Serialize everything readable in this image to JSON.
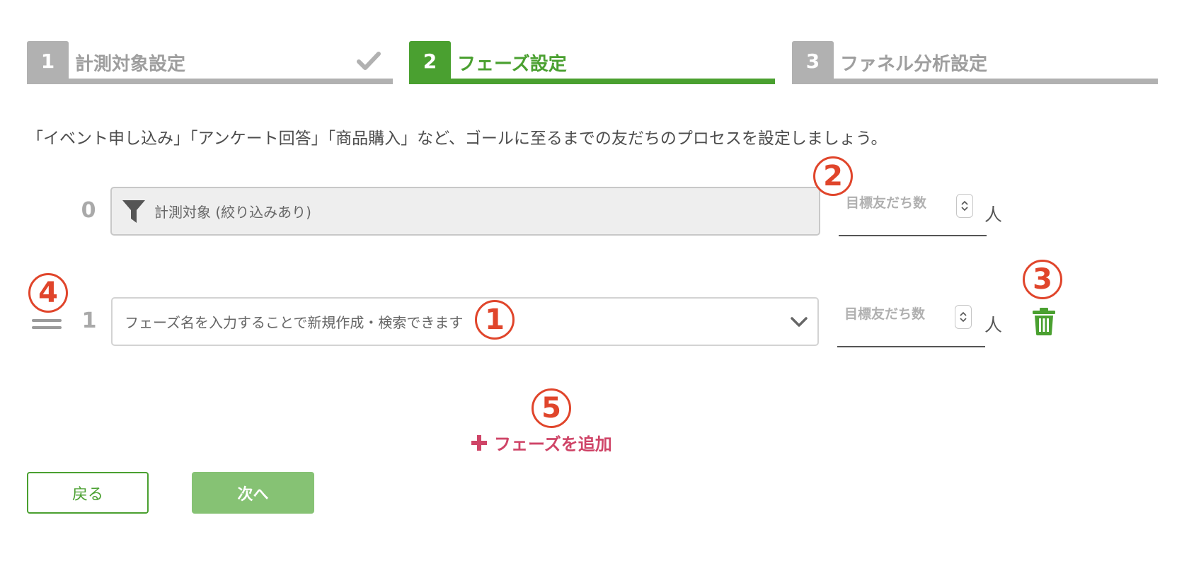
{
  "stepper": [
    {
      "number": "1",
      "label": "計測対象設定",
      "state": "completed"
    },
    {
      "number": "2",
      "label": "フェーズ設定",
      "state": "active"
    },
    {
      "number": "3",
      "label": "ファネル分析設定",
      "state": "upcoming"
    }
  ],
  "description": "「イベント申し込み」「アンケート回答」「商品購入」など、ゴールに至るまでの友だちのプロセスを設定しましょう。",
  "phases": [
    {
      "number": "0",
      "text": "計測対象 (絞り込みあり)",
      "target_label": "目標友だち数",
      "unit": "人"
    },
    {
      "number": "1",
      "placeholder": "フェーズ名を入力することで新規作成・検索できます",
      "target_label": "目標友だち数",
      "unit": "人"
    }
  ],
  "annotations": {
    "a1": "1",
    "a2": "2",
    "a3": "3",
    "a4": "4",
    "a5": "5"
  },
  "add_phase_label": "フェーズを追加",
  "buttons": {
    "back": "戻る",
    "next": "次へ"
  },
  "colors": {
    "primary_green": "#4aa030",
    "inactive_gray": "#b1b1b1",
    "add_pink": "#cf4467",
    "annotation_red": "#e0452b",
    "next_button": "#86c274"
  },
  "icons": {
    "step1_status": "check-icon",
    "phase0": "funnel-icon",
    "phase1_dropdown": "chevron-down-icon",
    "delete": "trash-icon",
    "reorder": "drag-handle-icon",
    "add": "plus-icon"
  }
}
